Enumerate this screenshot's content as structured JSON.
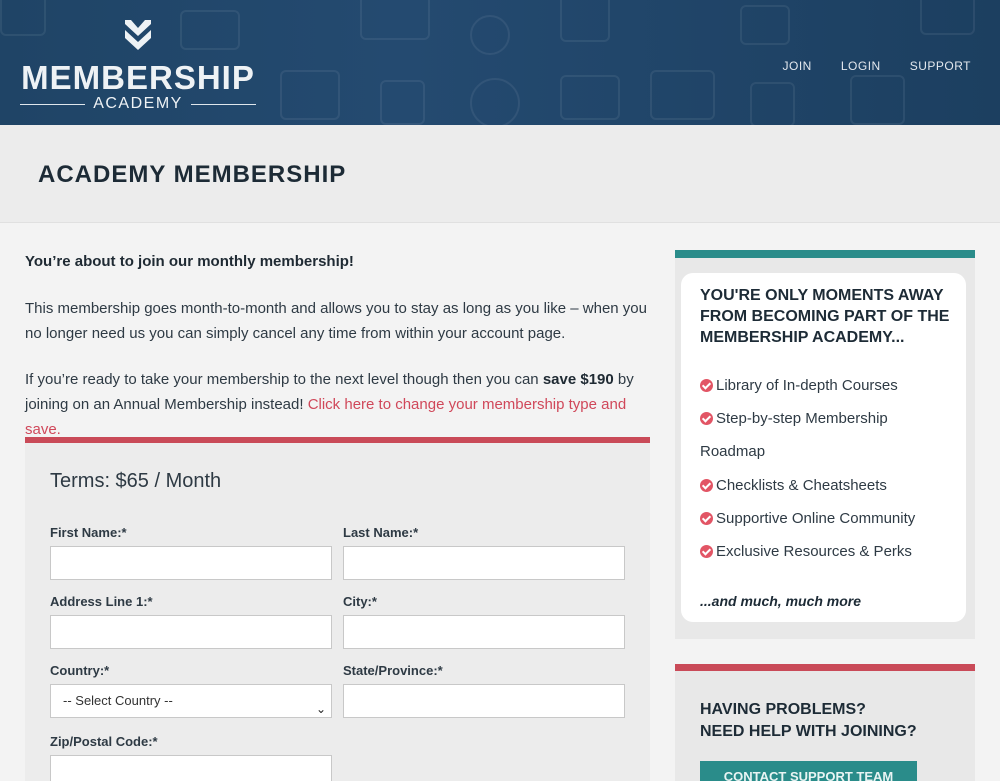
{
  "header": {
    "logo_main": "MEMBERSHIP",
    "logo_sub": "ACADEMY",
    "nav": [
      "JOIN",
      "LOGIN",
      "SUPPORT"
    ]
  },
  "page_title": "ACADEMY MEMBERSHIP",
  "intro": {
    "heading": "You’re about to join our monthly membership!",
    "para1": "This membership goes month-to-month and allows you to stay as long as you like – when you no longer need us you can simply cancel any time from within your account page.",
    "para2_pre": "If you’re ready to take your membership to the next level though then you can ",
    "para2_bold": "save $190",
    "para2_mid": " by joining on an Annual Membership instead! ",
    "para2_link": "Click here to change your membership type and save."
  },
  "form": {
    "terms": "Terms: $65 / Month",
    "first_name_label": "First Name:*",
    "last_name_label": "Last Name:*",
    "address_label": "Address Line 1:*",
    "city_label": "City:*",
    "country_label": "Country:*",
    "country_value": "-- Select Country --",
    "state_label": "State/Province:*",
    "zip_label": "Zip/Postal Code:*"
  },
  "sidebar": {
    "heading": "YOU'RE ONLY MOMENTS AWAY FROM BECOMING PART OF THE MEMBERSHIP ACADEMY...",
    "benefits": [
      "Library of In-depth Courses",
      "Step-by-step Membership",
      "Roadmap",
      "Checklists & Cheatsheets",
      "Supportive Online Community",
      "Exclusive Resources & Perks"
    ],
    "more": "...and much, much more",
    "help_line1": "HAVING PROBLEMS?",
    "help_line2": "NEED HELP WITH JOINING?",
    "support_button": "CONTACT SUPPORT TEAM"
  },
  "colors": {
    "header_bg": "#1f4466",
    "accent_red": "#c94a58",
    "accent_teal": "#2a8c8a",
    "link": "#d0485a"
  }
}
